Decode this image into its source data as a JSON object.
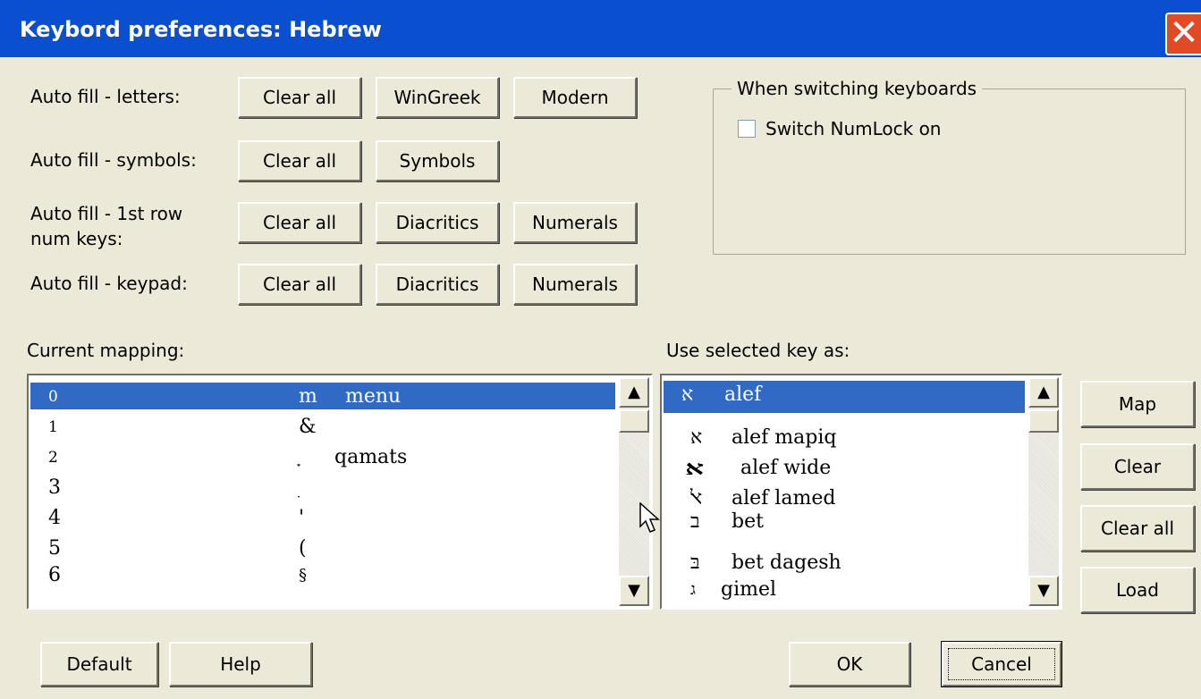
{
  "window": {
    "title": "Keybord preferences: Hebrew",
    "close_icon": "close-icon"
  },
  "autofill": {
    "letters": {
      "label": "Auto fill - letters:",
      "buttons": [
        "Clear all",
        "WinGreek",
        "Modern"
      ]
    },
    "symbols": {
      "label": "Auto fill - symbols:",
      "buttons": [
        "Clear all",
        "Symbols"
      ]
    },
    "numrow": {
      "label_line1": "Auto fill - 1st row",
      "label_line2": "num keys:",
      "buttons": [
        "Clear all",
        "Diacritics",
        "Numerals"
      ]
    },
    "keypad": {
      "label": "Auto fill - keypad:",
      "buttons": [
        "Clear all",
        "Diacritics",
        "Numerals"
      ]
    }
  },
  "switching": {
    "group_label": "When switching keyboards",
    "checkbox_label": "Switch NumLock on",
    "checked": false
  },
  "current_mapping": {
    "label": "Current mapping:",
    "rows": [
      {
        "key": "0",
        "symbol": "m",
        "desc": "menu",
        "selected": true
      },
      {
        "key": "1",
        "symbol": "&",
        "desc": ""
      },
      {
        "key": "2",
        "symbol": "ָ",
        "desc": "qamats"
      },
      {
        "key": "3",
        "symbol": "ׅ",
        "desc": ""
      },
      {
        "key": "4",
        "symbol": "'",
        "desc": ""
      },
      {
        "key": "5",
        "symbol": "(",
        "desc": ""
      },
      {
        "key": "6",
        "symbol": "§",
        "desc": ""
      }
    ]
  },
  "use_selected": {
    "label": "Use selected key as:",
    "rows": [
      {
        "glyph": "א",
        "name": "alef",
        "selected": true
      },
      {
        "glyph": "א",
        "name": "alef mapiq"
      },
      {
        "glyph": "א",
        "name": "alef wide"
      },
      {
        "glyph": "ﭏ",
        "name": "alef lamed"
      },
      {
        "glyph": "ב",
        "name": "bet"
      },
      {
        "glyph": "בּ",
        "name": "bet dagesh"
      },
      {
        "glyph": "ג",
        "name": "gimel"
      }
    ]
  },
  "side_buttons": {
    "map": "Map",
    "clear": "Clear",
    "clear_all": "Clear all",
    "load": "Load"
  },
  "bottom_buttons": {
    "default": "Default",
    "help": "Help",
    "ok": "OK",
    "cancel": "Cancel"
  },
  "icons": {
    "scroll_up": "scroll-up-arrow-icon",
    "scroll_down": "scroll-down-arrow-icon",
    "cursor": "mouse-pointer-icon"
  },
  "colors": {
    "titlebar": "#0a4fd0",
    "selection": "#316ac5",
    "dialog_bg": "#ece9d8",
    "close": "#e24a25"
  }
}
